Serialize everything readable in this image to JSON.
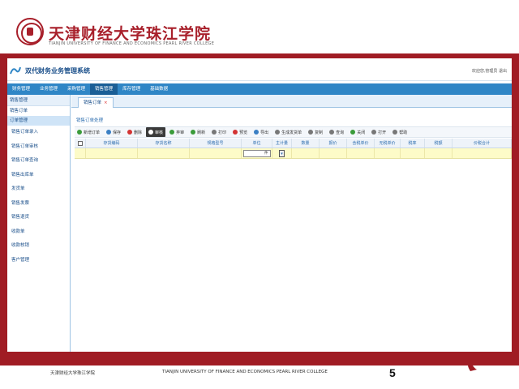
{
  "slide": {
    "college_name_cn": "天津财经大学珠江学院",
    "college_name_en": "TIANJIN UNIVERSITY OF FINANCE AND ECONOMICS PEARL RIVER COLLEGE",
    "footer_cn": "天津财经大学珠江学院",
    "footer_en": "TIANJIN UNIVERSITY OF FINANCE AND ECONOMICS PEARL RIVER COLLEGE",
    "page_number": "5",
    "accent_color": "#a01c24"
  },
  "app": {
    "title": "双代财务业务管理系统",
    "user_info": "欢迎您,管理员  退出",
    "menu": [
      {
        "label": "财务管理",
        "active": false
      },
      {
        "label": "业务管理",
        "active": false
      },
      {
        "label": "采购管理",
        "active": false
      },
      {
        "label": "销售管理",
        "active": true
      },
      {
        "label": "库存管理",
        "active": false
      },
      {
        "label": "基础数据",
        "active": false
      }
    ],
    "sidebar": {
      "header": "销售管理",
      "sub_sections": [
        "销售订单",
        "订单管理"
      ],
      "items": [
        "销售订单录入",
        "销售订单审核",
        "销售订单查询",
        "销售出库单",
        "发货单",
        "销售发票",
        "销售退货",
        "收款单",
        "收款核销",
        "客户管理"
      ]
    },
    "tab": {
      "label": "销售订单",
      "close": "×"
    },
    "breadcrumb": "销售订单处理",
    "toolbar": [
      {
        "label": "新增订单",
        "icon": "add-icon",
        "color": "#3a9b3a"
      },
      {
        "label": "保存",
        "icon": "save-icon",
        "color": "#3a7fc4"
      },
      {
        "label": "删除",
        "icon": "delete-icon",
        "color": "#d33333"
      },
      {
        "label": "审核",
        "icon": "check-icon",
        "color": "#ffffff",
        "dark": true
      },
      {
        "label": "弃审",
        "icon": "undo-icon",
        "color": "#3a9b3a"
      },
      {
        "label": "刷新",
        "icon": "refresh-icon",
        "color": "#3a9b3a"
      },
      {
        "label": "打印",
        "icon": "print-icon",
        "color": "#777777"
      },
      {
        "label": "预览",
        "icon": "preview-icon",
        "color": "#d33333"
      },
      {
        "label": "导出",
        "icon": "export-icon",
        "color": "#3a7fc4"
      },
      {
        "label": "生成发货单",
        "icon": "doc-icon",
        "color": "#777777"
      },
      {
        "label": "复制",
        "icon": "copy-icon",
        "color": "#777777"
      },
      {
        "label": "查询",
        "icon": "search-icon",
        "color": "#777777"
      },
      {
        "label": "关闭",
        "icon": "close-icon",
        "color": "#3a9b3a"
      },
      {
        "label": "打开",
        "icon": "open-icon",
        "color": "#777777"
      },
      {
        "label": "帮助",
        "icon": "help-icon",
        "color": "#777777"
      }
    ],
    "grid": {
      "columns": [
        "",
        "存货编码",
        "存货名称",
        "规格型号",
        "单位",
        "主计量",
        "数量",
        "报价",
        "含税单价",
        "无税单价",
        "税率",
        "税额",
        "价税合计"
      ],
      "row": {
        "select_value": "件"
      }
    }
  }
}
